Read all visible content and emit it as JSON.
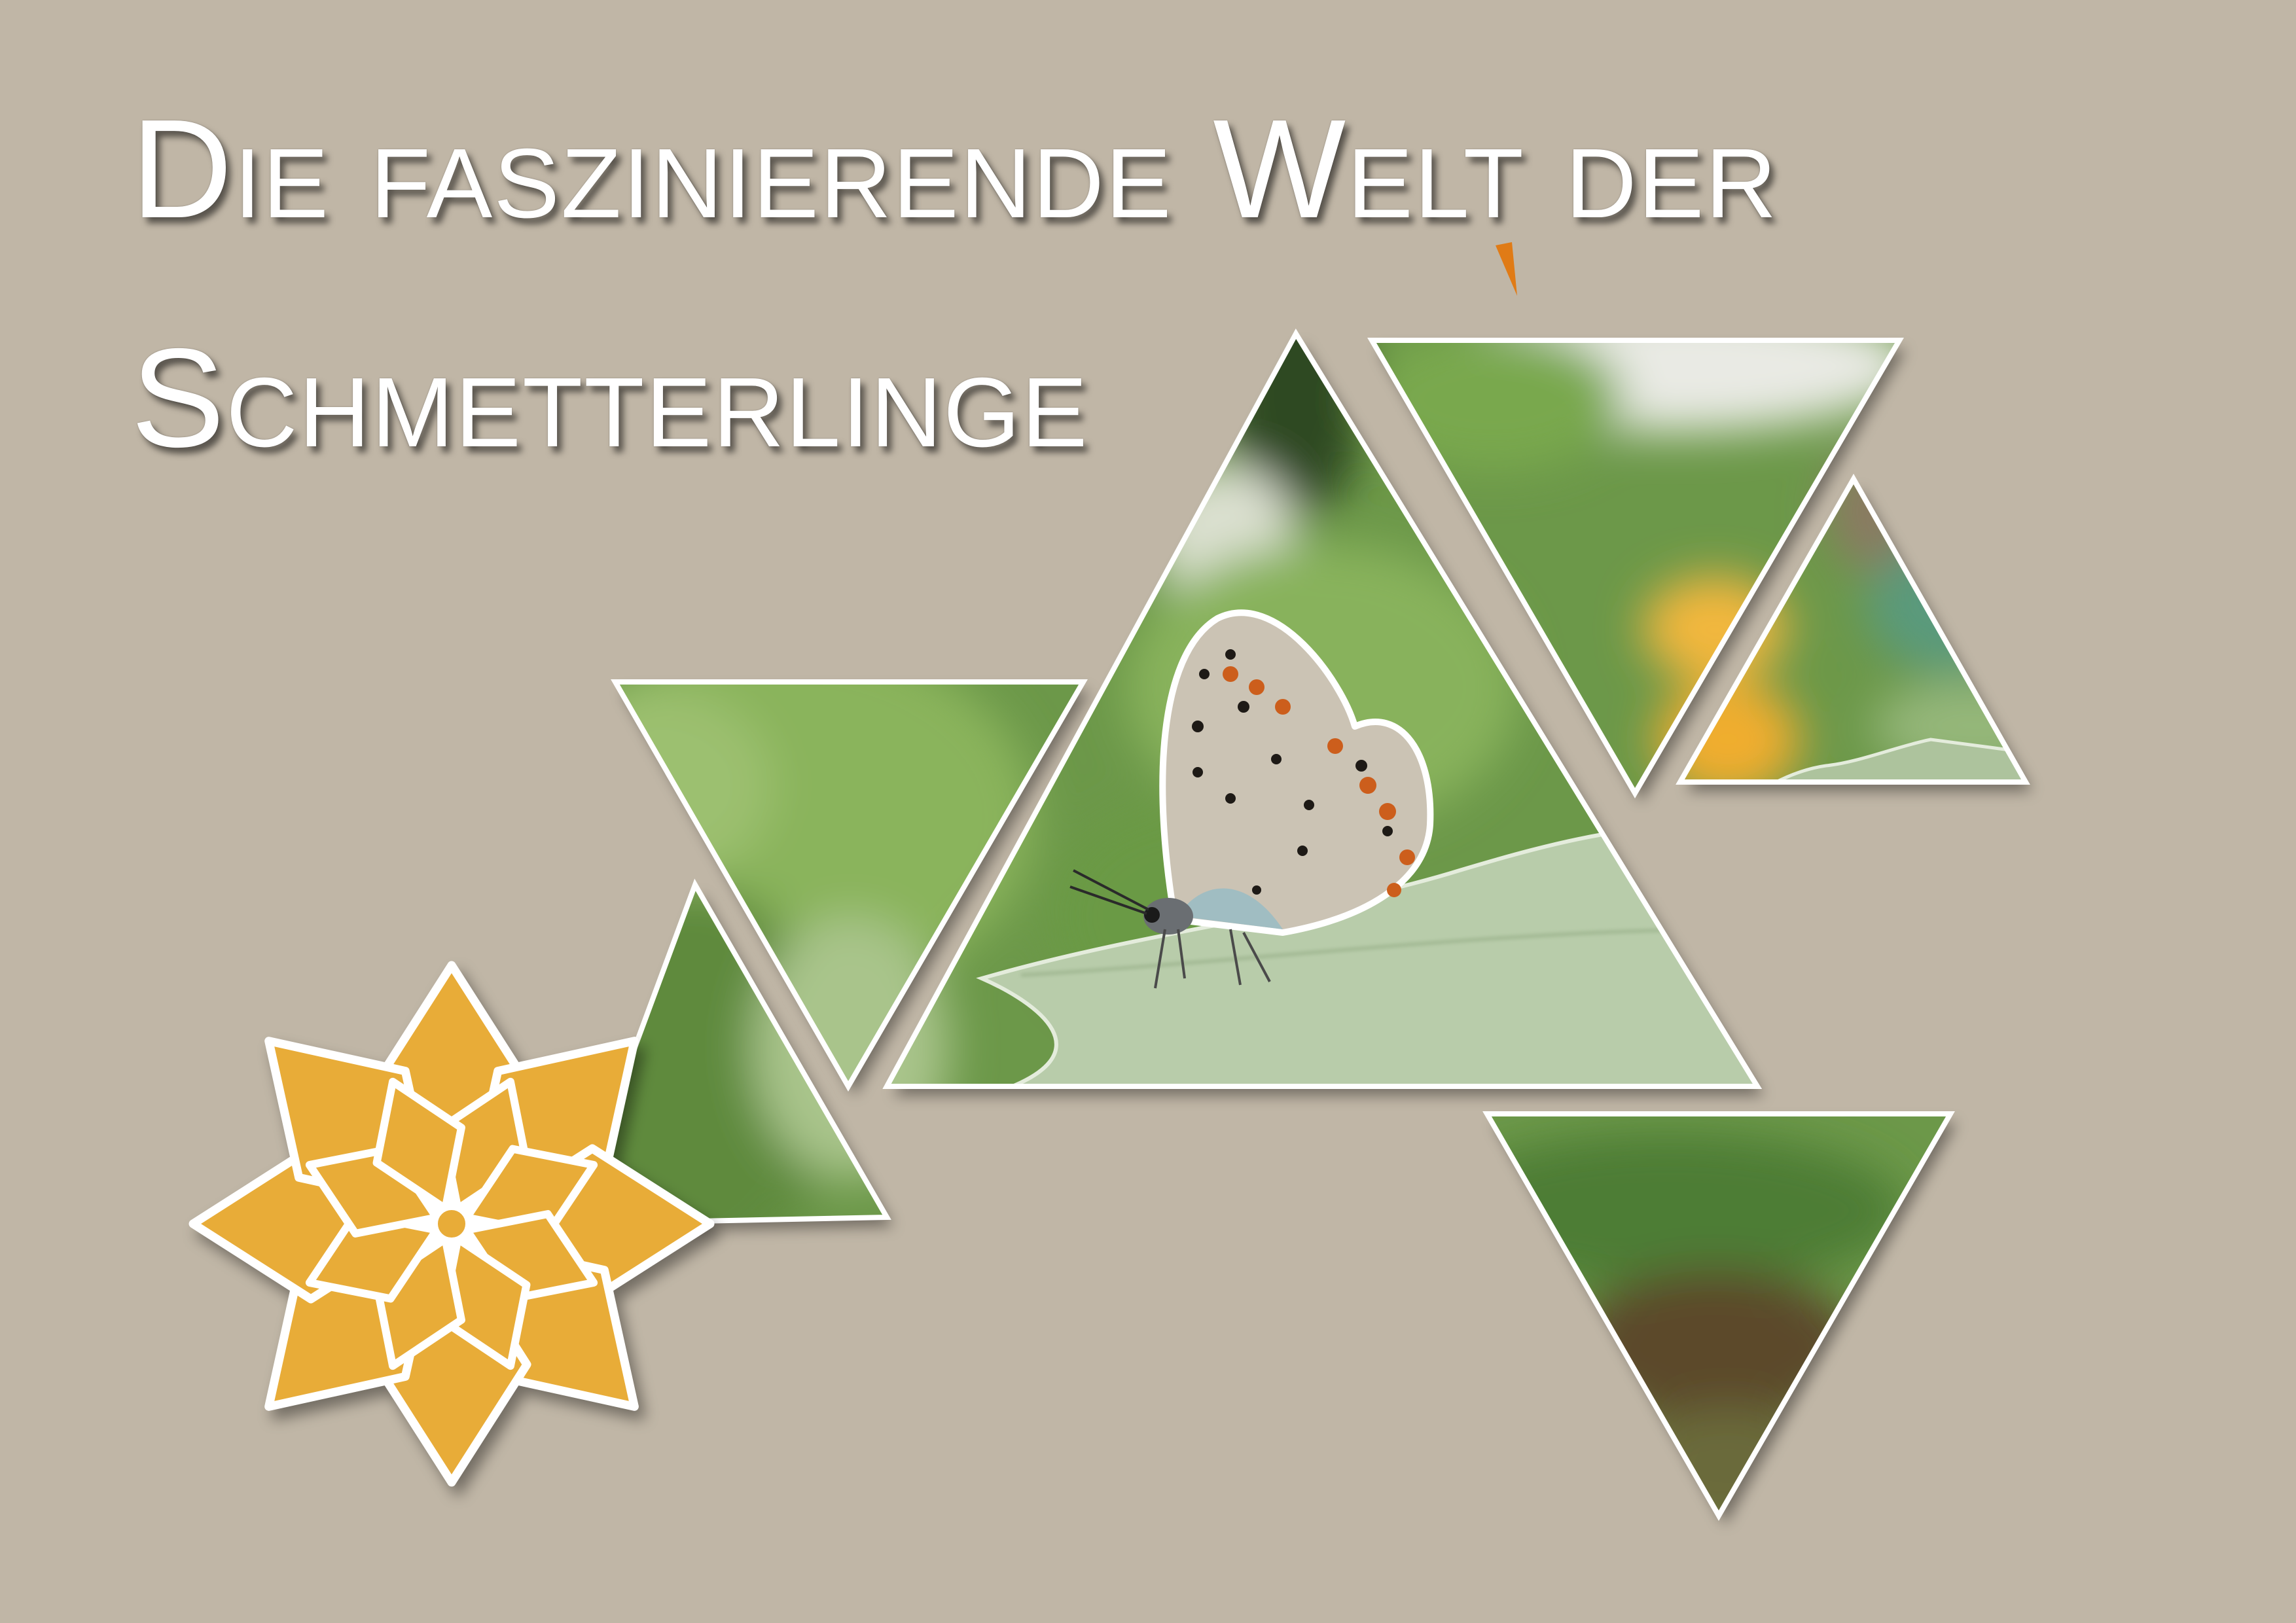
{
  "title": {
    "line1": "Die faszinierende Welt der",
    "line2": "Schmetterlinge"
  },
  "colors": {
    "background": "#c0b6a6",
    "title_text": "#ffffff",
    "flower_fill": "#e8ac38",
    "frame_stroke": "#ffffff"
  },
  "icons": {
    "decoration": "flower-icon",
    "subject": "butterfly"
  }
}
